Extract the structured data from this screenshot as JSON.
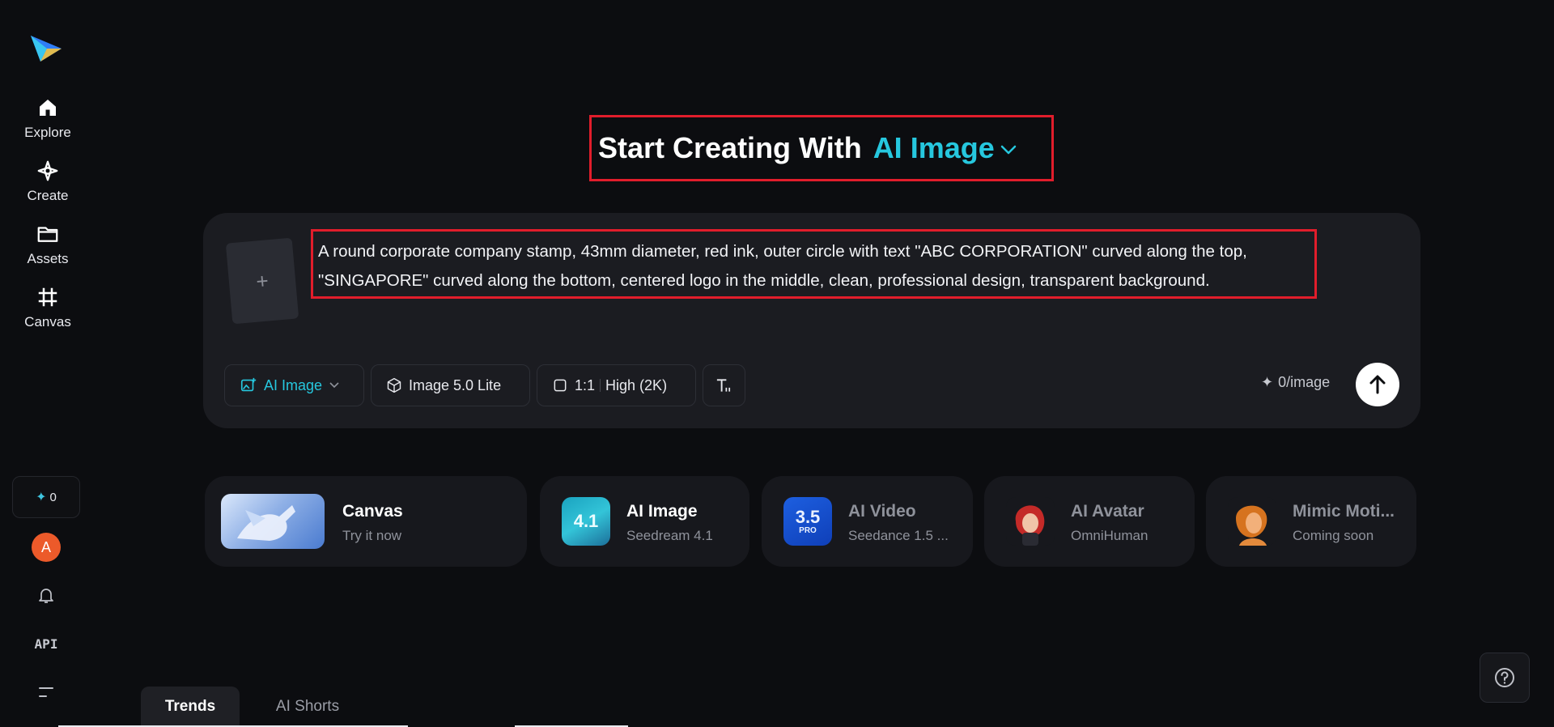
{
  "sidebar": {
    "items": [
      {
        "label": "Explore",
        "icon": "home-icon"
      },
      {
        "label": "Create",
        "icon": "sparkle-icon"
      },
      {
        "label": "Assets",
        "icon": "folder-icon"
      },
      {
        "label": "Canvas",
        "icon": "canvas-grid-icon"
      }
    ],
    "credits": "0",
    "avatar_initial": "A",
    "api_label": "API"
  },
  "heading": {
    "prefix": "Start Creating With",
    "mode": "AI Image"
  },
  "prompt": {
    "text": "A round corporate company stamp, 43mm diameter, red ink, outer circle with text \"ABC CORPORATION\" curved along the top, \"SINGAPORE\" curved along the bottom, centered logo in the middle, clean, professional design, transparent background.",
    "upload_symbol": "+"
  },
  "toolbar": {
    "mode_label": "AI Image",
    "model_label": "Image 5.0 Lite",
    "ratio_label": "1:1",
    "quality_label": "High (2K)",
    "cost_label": "0/image"
  },
  "features": [
    {
      "title": "Canvas",
      "subtitle": "Try it now"
    },
    {
      "title": "AI Image",
      "subtitle": "Seedream 4.1",
      "badge": "4.1"
    },
    {
      "title": "AI Video",
      "subtitle": "Seedance 1.5 ...",
      "badge": "3.5",
      "badge_sub": "PRO"
    },
    {
      "title": "AI Avatar",
      "subtitle": "OmniHuman"
    },
    {
      "title": "Mimic Moti...",
      "subtitle": "Coming soon"
    }
  ],
  "tabs": [
    {
      "label": "Trends",
      "active": true
    },
    {
      "label": "AI Shorts",
      "active": false
    }
  ],
  "colors": {
    "accent": "#26c7de",
    "background": "#0c0d10",
    "card": "#1b1c21",
    "highlight_box": "#e11d2b"
  }
}
